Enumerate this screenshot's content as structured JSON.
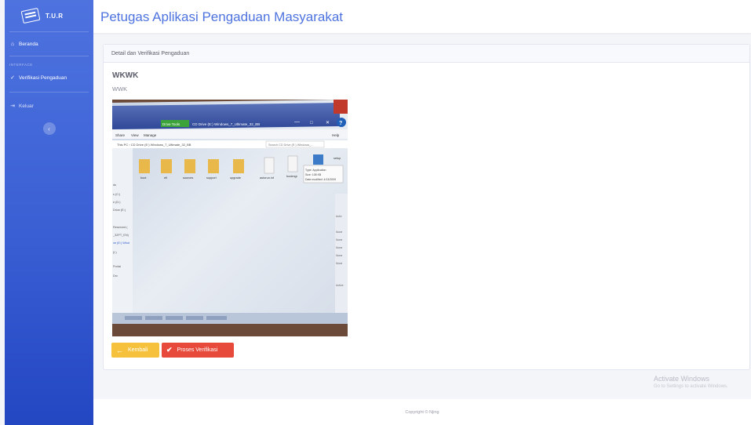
{
  "brand": {
    "name": "T.U.R",
    "icon": "keyboard-icon"
  },
  "sidebar": {
    "items": [
      {
        "label": "Beranda",
        "icon": "home-icon"
      },
      {
        "label": "Verifikasi Pengaduan",
        "icon": "check-icon"
      },
      {
        "label": "Keluar",
        "icon": "logout-icon"
      }
    ],
    "heading": "INTERFACE",
    "toggle_icon": "chevron-left-icon"
  },
  "header": {
    "title": "Petugas Aplikasi Pengaduan Masyarakat"
  },
  "card": {
    "header": "Detail dan Verifikasi Pengaduan",
    "report_title": "WKWK",
    "report_body": "WWK"
  },
  "photo_text": {
    "window_title": "CD Drive (E:) Windows_7_Ultimate_32_BB",
    "tab_tools": "Drive Tools",
    "ribbon": [
      "Share",
      "View",
      "Manage"
    ],
    "address": "This PC › CD Drive (E:) Windows_7_Ultimate_32_BB",
    "search": "Search CD Drive (E:) Windows_...",
    "folders": [
      "boot",
      "efi",
      "sources",
      "support",
      "upgrade"
    ],
    "files": [
      "autorun.inf",
      "bootmgr",
      "setup"
    ],
    "tooltip": [
      "Type: Application",
      "Size: 108 KB",
      "Date modified: 4/13/2009"
    ],
    "help": "Help"
  },
  "buttons": {
    "back": {
      "label": "Kembali",
      "icon": "arrow-left-icon"
    },
    "verify": {
      "label": "Proses Verifikasi",
      "icon": "check-icon"
    }
  },
  "watermark": {
    "line1": "Activate Windows",
    "line2": "Go to Settings to activate Windows."
  },
  "footer": {
    "copyright": "Copyright © Njing"
  },
  "colors": {
    "primary": "#4e73df",
    "warning": "#f6c23e",
    "danger": "#e74a3b"
  }
}
